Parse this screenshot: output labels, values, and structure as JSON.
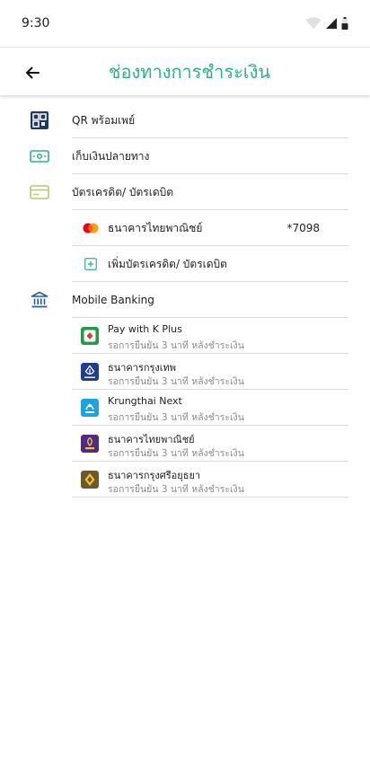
{
  "status": {
    "time": "9:30"
  },
  "header": {
    "title": "ช่องทางการชำระเงิน"
  },
  "methods": {
    "qr": "QR พร้อมเพย์",
    "cod": "เก็บเงินปลายทาง",
    "card": "บัตรเครดิต/ บัตรเดบิต",
    "saved_card_bank": "ธนาคารไทยพาณิชย์",
    "saved_card_number": "*7098",
    "add_card": "เพิ่มบัตรเครดิต/ บัตรเดบิต",
    "mobile_banking": "Mobile Banking"
  },
  "banks": [
    {
      "name": "Pay with K Plus",
      "note": "รอการยืนยัน 3 นาที หลังชำระเงิน"
    },
    {
      "name": "ธนาคารกรุงเทพ",
      "note": "รอการยืนยัน 3 นาที หลังชำระเงิน"
    },
    {
      "name": "Krungthai Next",
      "note": "รอการยืนยัน 3 นาที หลังชำระเงิน"
    },
    {
      "name": "ธนาคารไทยพาณิชย์",
      "note": "รอการยืนยัน 3 นาที หลังชำระเงิน"
    },
    {
      "name": "ธนาคารกรุงศรีอยุธยา",
      "note": "รอการยืนยัน 3 นาที หลังชำระเงิน"
    }
  ],
  "colors": {
    "accent": "#2bb38a",
    "kplus": "#1e9e4a",
    "bbl": "#1e3d8f",
    "ktb": "#1aa3e0",
    "scb": "#4e2a84",
    "krungsri": "#6b5a2b"
  }
}
